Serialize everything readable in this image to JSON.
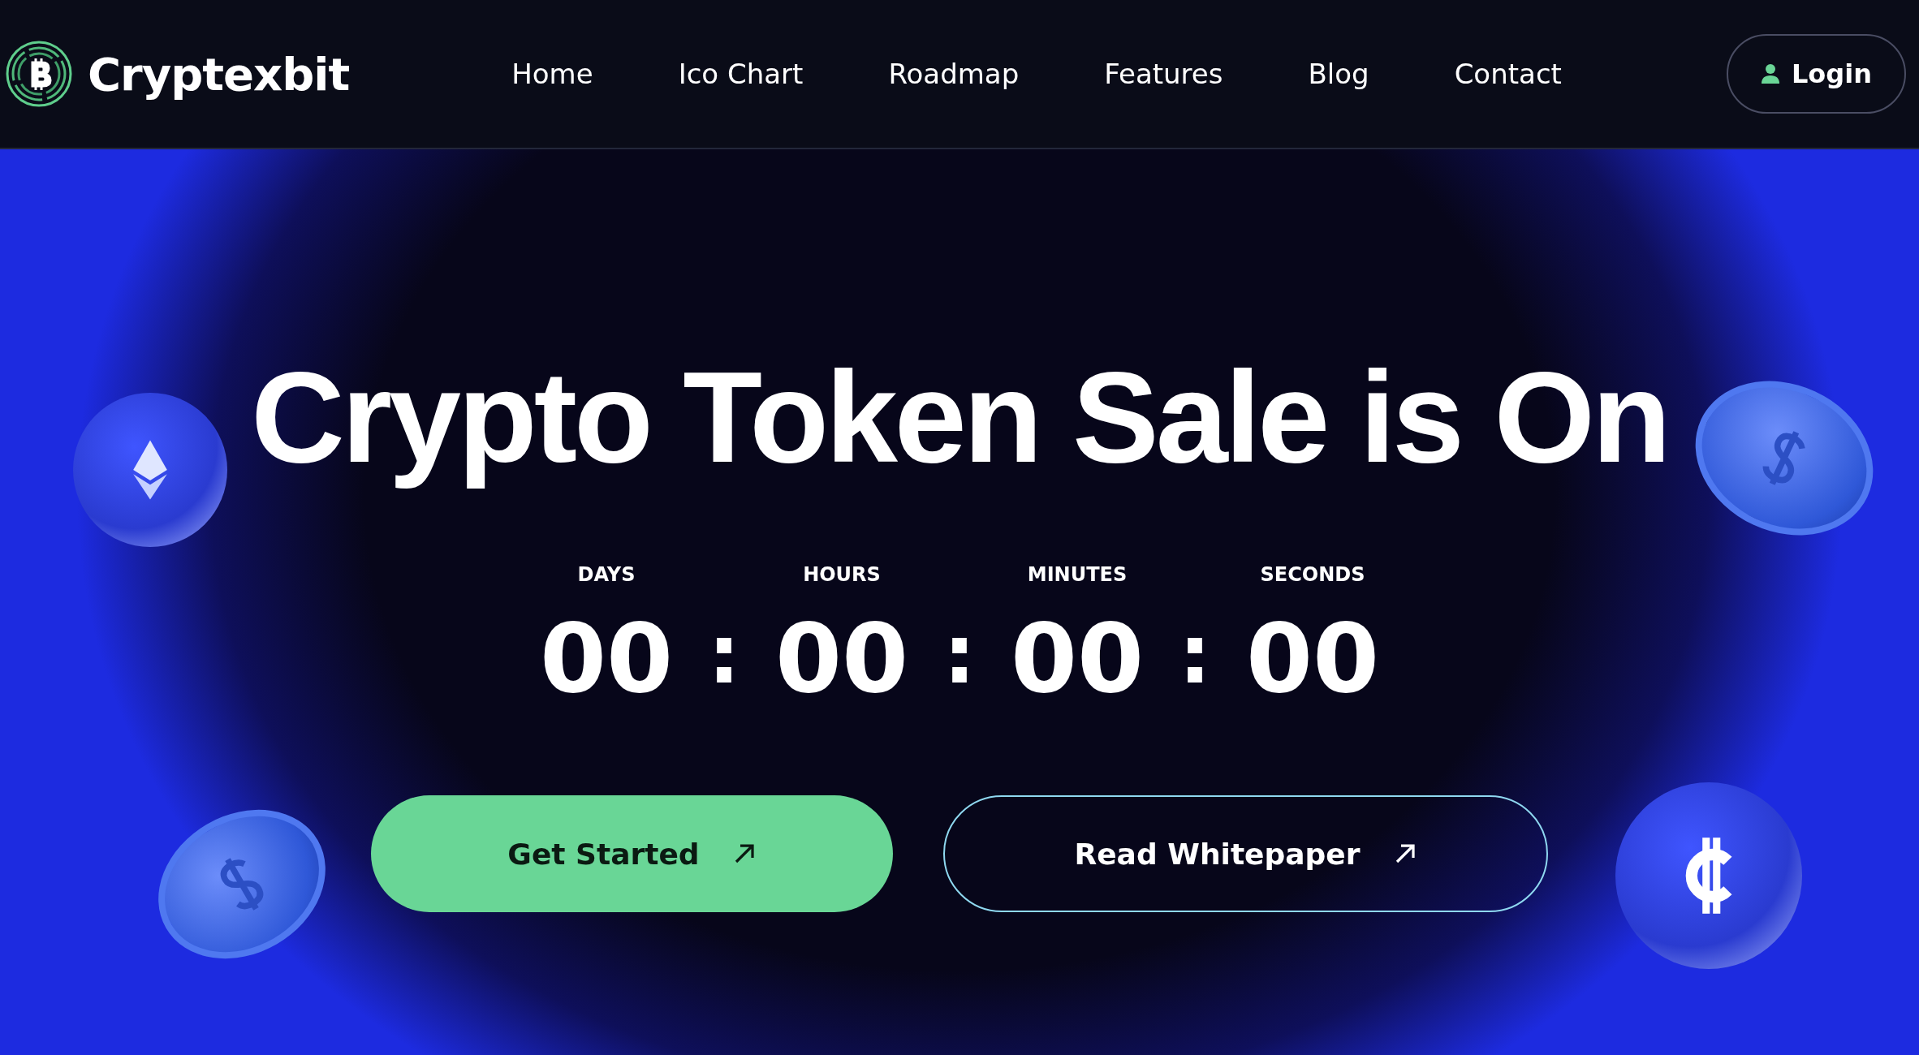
{
  "brand": {
    "name": "Cryptexbit"
  },
  "nav": [
    {
      "label": "Home"
    },
    {
      "label": "Ico Chart"
    },
    {
      "label": "Roadmap"
    },
    {
      "label": "Features"
    },
    {
      "label": "Blog"
    },
    {
      "label": "Contact"
    }
  ],
  "login_button": {
    "label": "Login"
  },
  "hero": {
    "title": "Crypto Token Sale is On",
    "countdown": {
      "units": [
        {
          "label": "DAYS",
          "value": "00"
        },
        {
          "label": "HOURS",
          "value": "00"
        },
        {
          "label": "MINUTES",
          "value": "00"
        },
        {
          "label": "SECONDS",
          "value": "00"
        }
      ],
      "separators": [
        ":",
        ":",
        ":"
      ]
    },
    "buttons": [
      {
        "label": "Get Started",
        "kind": "filled"
      },
      {
        "label": "Read Whitepaper",
        "kind": "outline"
      }
    ]
  }
}
